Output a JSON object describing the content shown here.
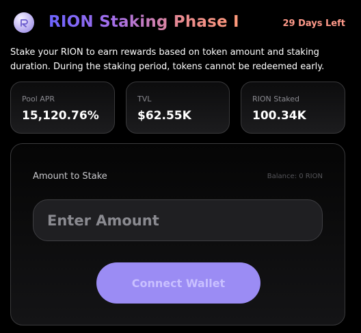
{
  "header": {
    "logo_icon": "rion-logo-icon",
    "title": "RION Staking Phase I",
    "days_left": "29 Days Left",
    "colors": {
      "title_gradient_start": "#6b63ff",
      "title_gradient_end": "#ff9a7a",
      "days_left": "#ff9a8a"
    }
  },
  "description": "Stake your RION to earn rewards based on token amount and staking duration. During the staking period, tokens cannot be redeemed early.",
  "stats": {
    "pool_apr": {
      "label": "Pool APR",
      "value": "15,120.76%"
    },
    "tvl": {
      "label": "TVL",
      "value": "$62.55K"
    },
    "rion_staked": {
      "label": "RION Staked",
      "value": "100.34K"
    }
  },
  "stake": {
    "amount_label": "Amount to Stake",
    "balance": "Balance: 0 RION",
    "input_value": "",
    "input_placeholder": "Enter Amount",
    "connect_label": "Connect Wallet",
    "colors": {
      "button_bg": "#9b8cf4",
      "button_text": "#c9c0ff"
    }
  }
}
